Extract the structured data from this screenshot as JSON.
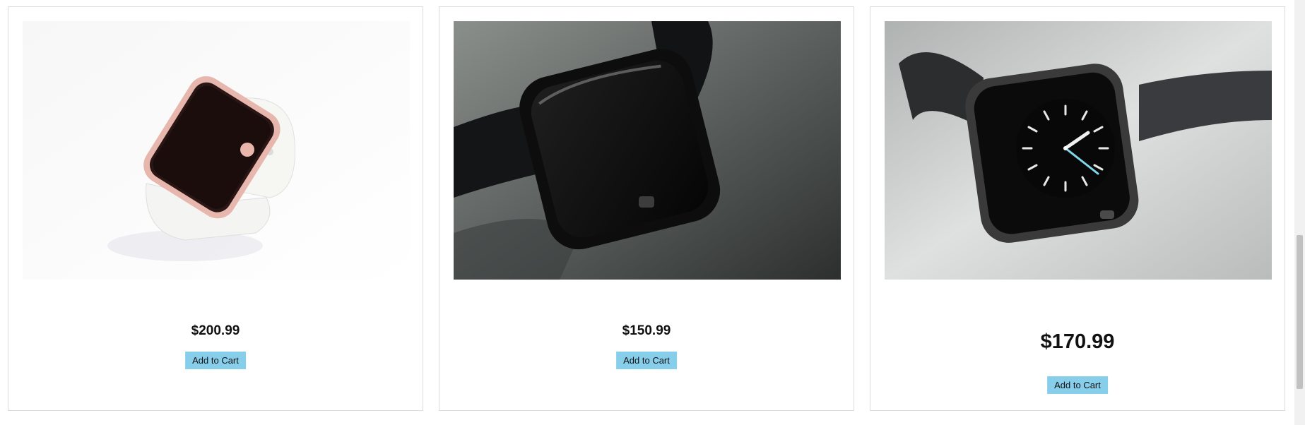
{
  "products": [
    {
      "price": "$200.99",
      "button_label": "Add to Cart",
      "image": "rose-gold-watch-white-band"
    },
    {
      "price": "$150.99",
      "button_label": "Add to Cart",
      "image": "black-watch-dark-screen"
    },
    {
      "price": "$170.99",
      "button_label": "Add to Cart",
      "image": "black-watch-analog-face"
    }
  ],
  "colors": {
    "button_bg": "#87ceeb",
    "card_border": "#dcdcdc",
    "price_text": "#111111"
  }
}
